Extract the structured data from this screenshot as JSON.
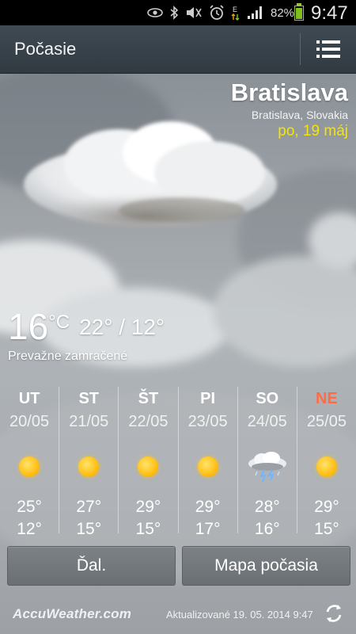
{
  "status_bar": {
    "battery_percent": "82%",
    "time": "9:47",
    "icons": [
      "eye-icon",
      "bluetooth-icon",
      "no-sound-icon",
      "alarm-icon",
      "data-e-icon",
      "signal-icon",
      "battery-icon"
    ]
  },
  "app_bar": {
    "title": "Počasie",
    "menu_icon": "list-menu-icon"
  },
  "location": {
    "city": "Bratislava",
    "region": "Bratislava, Slovakia",
    "date": "po, 19 máj",
    "date_color": "#f5e500"
  },
  "current": {
    "temp": "16",
    "unit": "°C",
    "hi_lo": "22° / 12°",
    "condition": "Prevažne zamračené"
  },
  "forecast": [
    {
      "day": "UT",
      "date": "20/05",
      "icon": "sun-icon",
      "hi": "25°",
      "lo": "12°"
    },
    {
      "day": "ST",
      "date": "21/05",
      "icon": "sun-icon",
      "hi": "27°",
      "lo": "15°"
    },
    {
      "day": "ŠT",
      "date": "22/05",
      "icon": "sun-icon",
      "hi": "29°",
      "lo": "15°"
    },
    {
      "day": "PI",
      "date": "23/05",
      "icon": "sun-icon",
      "hi": "29°",
      "lo": "17°"
    },
    {
      "day": "SO",
      "date": "24/05",
      "icon": "thunderstorm-icon",
      "hi": "28°",
      "lo": "16°"
    },
    {
      "day": "NE",
      "date": "25/05",
      "icon": "sun-icon",
      "hi": "29°",
      "lo": "15°"
    }
  ],
  "buttons": {
    "more": "Ďal.",
    "map": "Mapa počasia"
  },
  "footer": {
    "brand": "AccuWeather.com",
    "updated": "Aktualizované 19. 05. 2014 9:47"
  },
  "colors": {
    "sunday": "#ff6b45",
    "app_bar": "#3a444c"
  }
}
